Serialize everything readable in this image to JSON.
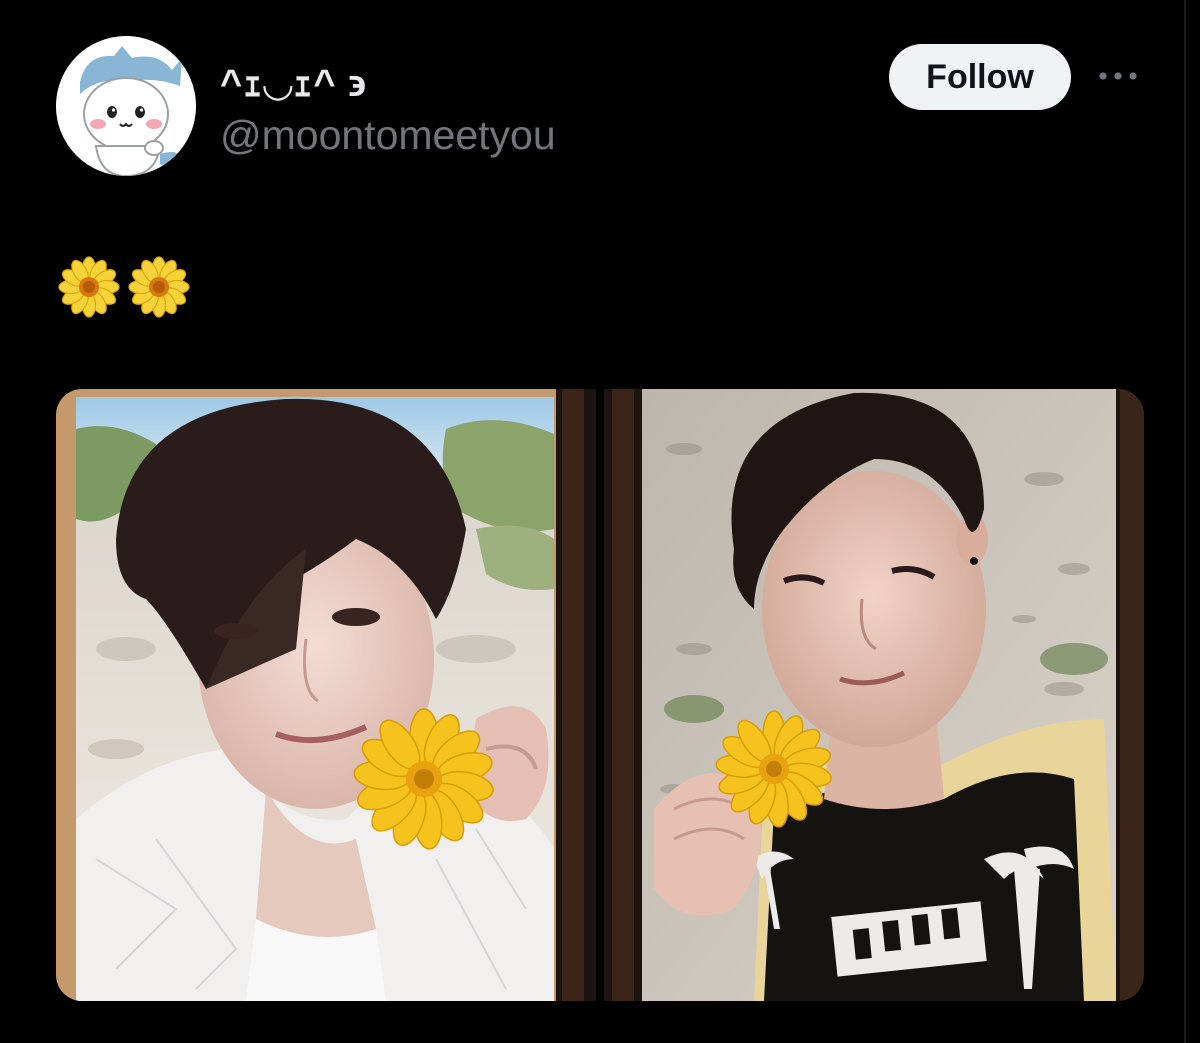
{
  "author": {
    "display_name": "^ｪ◡ｪ^ ϶",
    "handle": "@moontomeetyou",
    "avatar_icon": "chiikawa-hachiware-avatar"
  },
  "actions": {
    "follow_label": "Follow",
    "more_icon": "more-horizontal-icon"
  },
  "tweet": {
    "emojis": [
      "🌼",
      "🌼"
    ]
  },
  "media": {
    "photos": [
      {
        "name": "photo-card-left",
        "icon": "photocard-white-shirt-flower"
      },
      {
        "name": "photo-card-right",
        "icon": "photocard-black-shirt-flower"
      }
    ]
  },
  "colors": {
    "background": "#000000",
    "primary_text": "#e7e9ea",
    "secondary_text": "#71767b",
    "follow_bg": "#eff3f4",
    "follow_text": "#0f1419"
  }
}
